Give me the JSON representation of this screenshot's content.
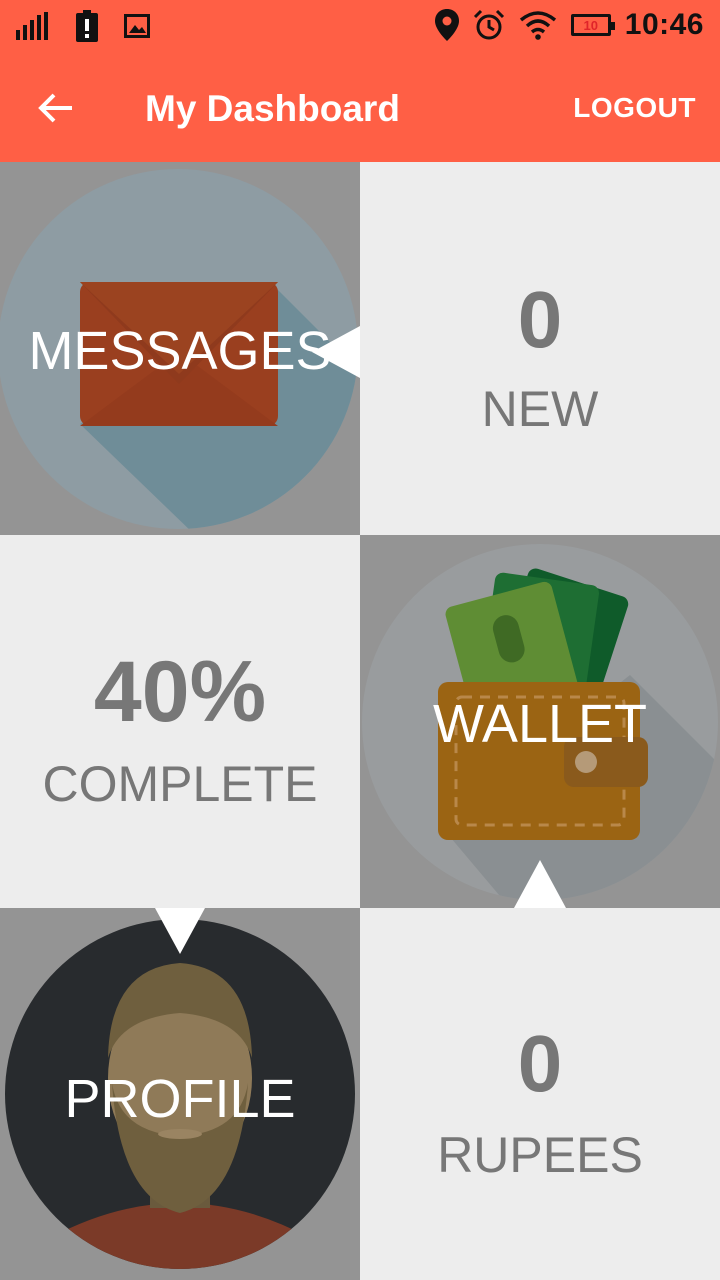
{
  "status_bar": {
    "time": "10:46",
    "battery_level": "10"
  },
  "app_bar": {
    "title": "My Dashboard",
    "logout_label": "LOGOUT"
  },
  "tiles": {
    "messages": {
      "label": "MESSAGES",
      "count": "0",
      "count_caption": "NEW"
    },
    "profile_progress": {
      "value": "40%",
      "caption": "COMPLETE"
    },
    "wallet": {
      "label": "WALLET",
      "amount": "0",
      "amount_caption": "RUPEES"
    },
    "profile": {
      "label": "PROFILE"
    }
  },
  "colors": {
    "primary": "#ff5f45",
    "tile_grey": "#949494",
    "tile_light": "#ededed",
    "text_grey": "#777777"
  }
}
